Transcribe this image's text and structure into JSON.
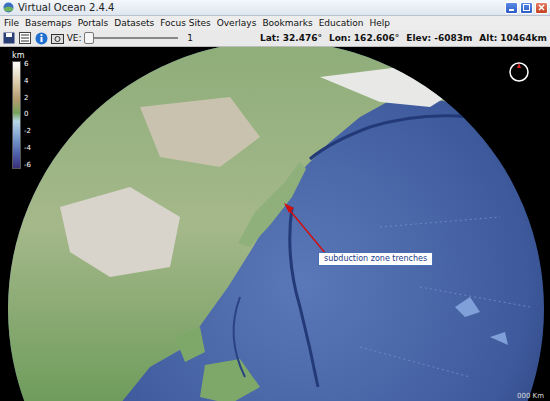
{
  "window": {
    "title": "Virtual Ocean 2.4.4"
  },
  "menu": [
    "File",
    "Basemaps",
    "Portals",
    "Datasets",
    "Focus Sites",
    "Overlays",
    "Bookmarks",
    "Education",
    "Help"
  ],
  "toolbar": {
    "ve_label": "VE:",
    "ve_value": "1",
    "ve_level": 0,
    "readings": [
      {
        "label": "Lat:",
        "value": "32.476°"
      },
      {
        "label": "Lon:",
        "value": "162.606°"
      },
      {
        "label": "Elev:",
        "value": "-6083m"
      },
      {
        "label": "Alt:",
        "value": "10464km"
      }
    ]
  },
  "legend": {
    "unit": "km",
    "ticks": [
      "6",
      "4",
      "2",
      "0",
      "-2",
      "-4",
      "-6"
    ]
  },
  "annotation": {
    "label": "subduction zone trenches"
  },
  "scale": {
    "label": "000 Km"
  }
}
